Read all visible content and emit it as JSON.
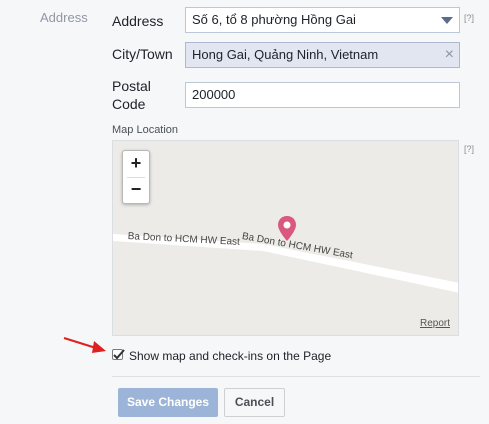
{
  "section": {
    "label": "Address"
  },
  "address": {
    "label": "Address",
    "value": "Số 6, tổ 8 phường Hồng Gai",
    "help": "[?]"
  },
  "city": {
    "label": "City/Town",
    "value": "Hong Gai, Quảng Ninh, Vietnam",
    "clear": "×"
  },
  "postal": {
    "label_line1": "Postal",
    "label_line2": "Code",
    "value": "200000"
  },
  "map": {
    "label": "Map Location",
    "help": "[?]",
    "zoom_in": "+",
    "zoom_out": "−",
    "road_label_1": "Ba Don to HCM HW East",
    "road_label_2": "Ba Don to HCM HW East",
    "report": "Report"
  },
  "checkbox": {
    "checked": true,
    "label": "Show map and check-ins on the Page"
  },
  "buttons": {
    "save": "Save Changes",
    "cancel": "Cancel"
  },
  "colors": {
    "pin": "#d9587e",
    "arrow": "#e02020",
    "primary_button": "#9cb4d8"
  }
}
